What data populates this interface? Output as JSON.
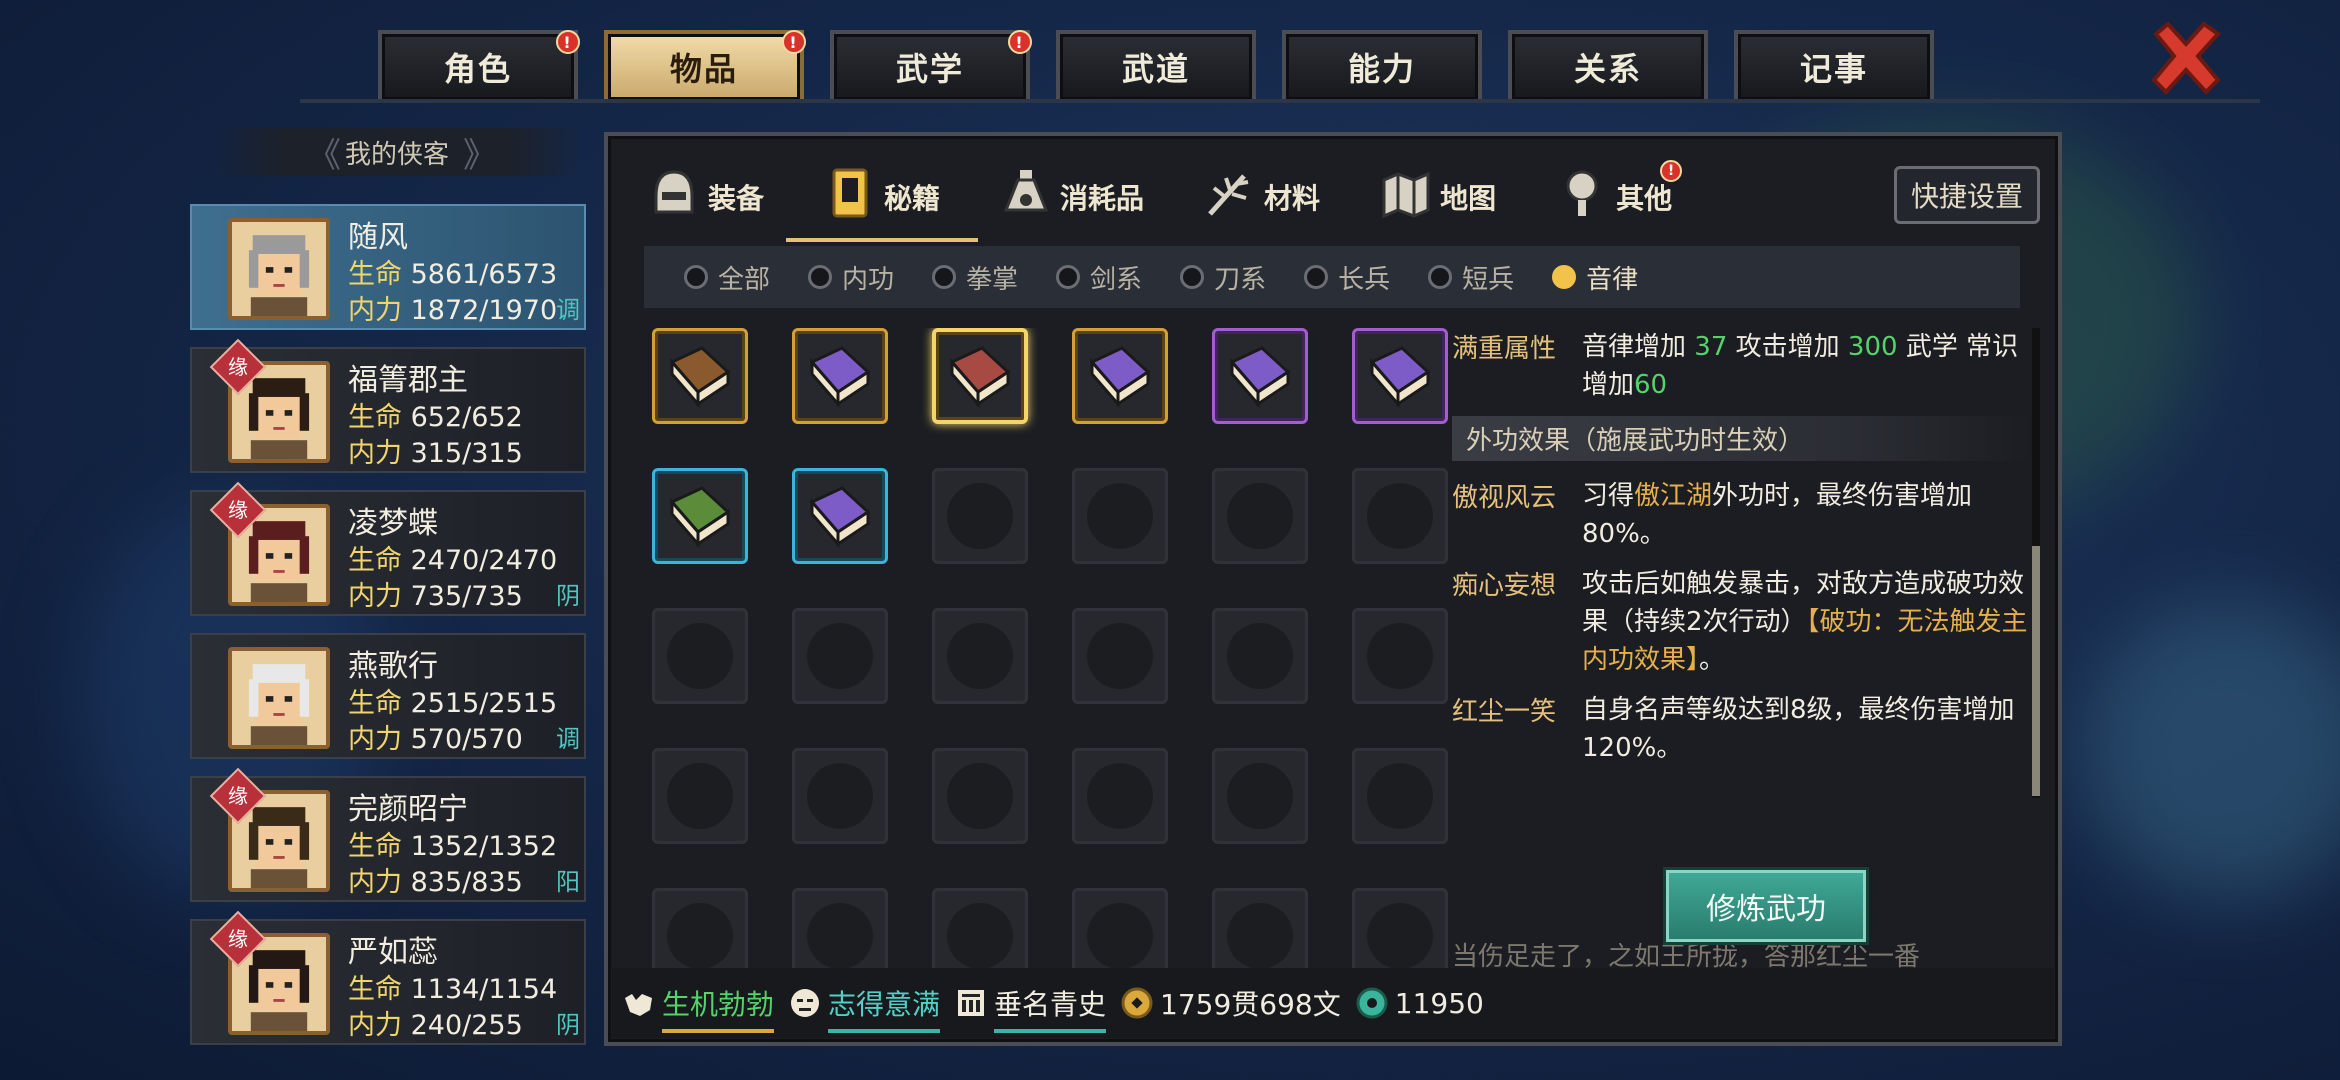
{
  "top_tabs": [
    {
      "label": "角色",
      "badge": "!"
    },
    {
      "label": "物品",
      "badge": "!",
      "active": true
    },
    {
      "label": "武学",
      "badge": "!"
    },
    {
      "label": "武道"
    },
    {
      "label": "能力"
    },
    {
      "label": "关系"
    },
    {
      "label": "记事"
    }
  ],
  "roster": {
    "header": "我的侠客",
    "stat_labels": {
      "hp": "生命",
      "mp": "内力"
    },
    "heroes": [
      {
        "name": "随风",
        "hp": "5861/6573",
        "mp": "1872/1970",
        "tag": "调",
        "selected": true
      },
      {
        "name": "福箐郡主",
        "hp": "652/652",
        "mp": "315/315",
        "tag": "",
        "yuan": "缘"
      },
      {
        "name": "凌梦蝶",
        "hp": "2470/2470",
        "mp": "735/735",
        "tag": "阴",
        "yuan": "缘"
      },
      {
        "name": "燕歌行",
        "hp": "2515/2515",
        "mp": "570/570",
        "tag": "调"
      },
      {
        "name": "完颜昭宁",
        "hp": "1352/1352",
        "mp": "835/835",
        "tag": "阳",
        "yuan": "缘"
      },
      {
        "name": "严如蕊",
        "hp": "1134/1154",
        "mp": "240/255",
        "tag": "阴",
        "yuan": "缘"
      }
    ]
  },
  "sub_tabs": [
    {
      "label": "装备",
      "icon": "helmet-icon"
    },
    {
      "label": "秘籍",
      "icon": "book-icon",
      "active": true
    },
    {
      "label": "消耗品",
      "icon": "potion-icon"
    },
    {
      "label": "材料",
      "icon": "herb-icon"
    },
    {
      "label": "地图",
      "icon": "map-icon"
    },
    {
      "label": "其他",
      "icon": "lantern-icon",
      "badge": "!"
    }
  ],
  "quick_settings": "快捷设置",
  "filters": [
    "全部",
    "内功",
    "拳掌",
    "剑系",
    "刀系",
    "长兵",
    "短兵",
    "音律"
  ],
  "active_filter": "音律",
  "items": [
    {
      "color": "#8a5a2e",
      "rarity": "gold"
    },
    {
      "color": "#7e5cc8",
      "rarity": "gold"
    },
    {
      "color": "#a84a44",
      "rarity": "gold",
      "selected": true
    },
    {
      "color": "#7e5cc8",
      "rarity": "gold"
    },
    {
      "color": "#7e5cc8",
      "rarity": "purple"
    },
    {
      "color": "#7e5cc8",
      "rarity": "purple"
    },
    {
      "color": "#5a8c3a",
      "rarity": "cyan"
    },
    {
      "color": "#7e5cc8",
      "rarity": "cyan"
    }
  ],
  "detail": {
    "attr_key": "满重属性",
    "attr_parts": [
      "音律增加",
      "37",
      "攻击增加",
      "300",
      "武学",
      "常识增加",
      "60"
    ],
    "section_title": "外功效果（施展武功时生效）",
    "effects": [
      {
        "key": "傲视风云",
        "pre": "习得",
        "highlight": "傲江湖",
        "post": "外功时，最终伤害增加80%。"
      },
      {
        "key": "痴心妄想",
        "pre": "攻击后如触发暴击，对敌方造成破功效果（持续2次行动）",
        "highlight": "【破功：无法触发主内功效果】",
        "post": "。"
      },
      {
        "key": "红尘一笑",
        "pre": "自身名声等级达到8级，最终伤害增加120%。",
        "highlight": "",
        "post": ""
      }
    ],
    "fade_text": "当伤足走了，之如王所拢，答那红尘一番"
  },
  "train_button": "修炼武功",
  "status": {
    "s1": "生机勃勃",
    "s2": "志得意满",
    "s3": "垂名青史",
    "money": "1759贯698文",
    "jade": "11950"
  }
}
